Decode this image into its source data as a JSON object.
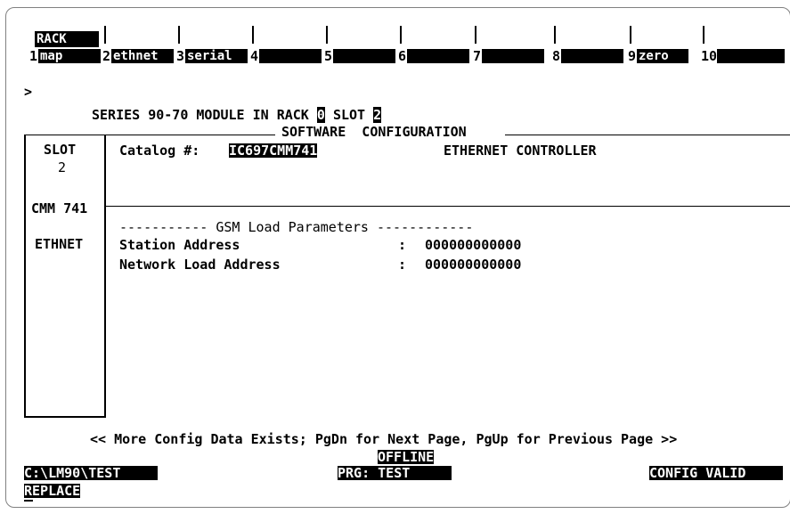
{
  "fkeys": [
    {
      "num": "1",
      "label": "map",
      "upper": "RACK"
    },
    {
      "num": "2",
      "label": "ethnet"
    },
    {
      "num": "3",
      "label": "serial"
    },
    {
      "num": "4",
      "label": ""
    },
    {
      "num": "5",
      "label": ""
    },
    {
      "num": "6",
      "label": ""
    },
    {
      "num": "7",
      "label": ""
    },
    {
      "num": "8",
      "label": ""
    },
    {
      "num": "9",
      "label": "zero"
    },
    {
      "num": "10",
      "label": ""
    }
  ],
  "prompt": ">",
  "header": {
    "line": "SERIES 90-70 MODULE IN RACK",
    "rack": "0",
    "slot_label": "SLOT",
    "slot": "2",
    "section": "SOFTWARE  CONFIGURATION"
  },
  "slot_panel": {
    "slot_title": "SLOT",
    "slot_num": "2",
    "module": "CMM 741",
    "type": "ETHNET"
  },
  "catalog": {
    "label": "Catalog #:",
    "value": "IC697CMM741",
    "description": "ETHERNET CONTROLLER"
  },
  "gsm": {
    "title": "----------- GSM Load Parameters ------------",
    "rows": [
      {
        "label": "Station Address",
        "sep": ":",
        "value": "000000000000"
      },
      {
        "label": "Network Load Address",
        "sep": ":",
        "value": "000000000000"
      }
    ]
  },
  "footer_message": "<< More Config Data Exists; PgDn for Next Page, PgUp for Previous Page >>",
  "status": {
    "mode": "OFFLINE",
    "path": "C:\\LM90\\TEST",
    "program": "PRG: TEST",
    "config": "CONFIG VALID",
    "edit_mode": "REPLACE"
  }
}
